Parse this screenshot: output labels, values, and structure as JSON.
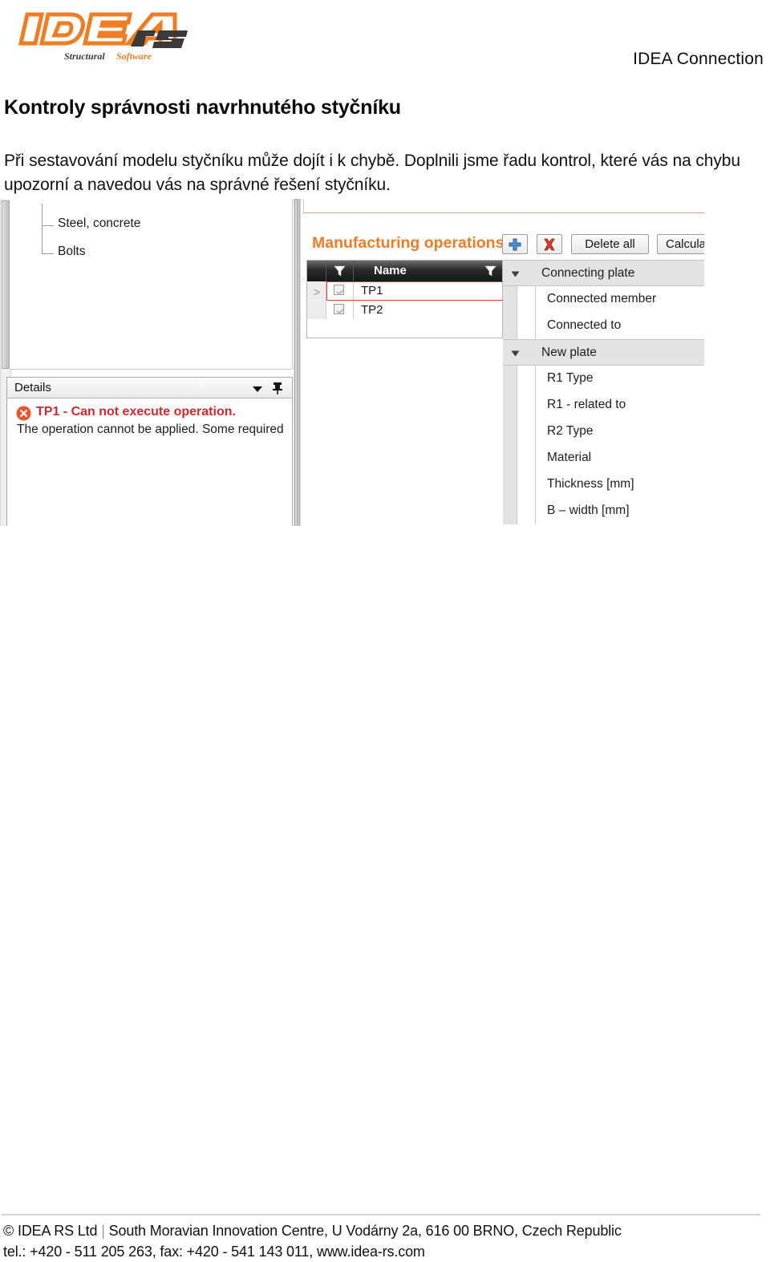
{
  "header": {
    "logo": {
      "name": "idea-rs-logo",
      "word_mark": "IDEA",
      "word_mark_suffix": "rs",
      "tagline_dark": "Structural",
      "tagline_orange": "Software",
      "orange": "#f07d23",
      "dark": "#3a3a3a"
    },
    "app_name": "IDEA Connection"
  },
  "page_title": "Kontroly správnosti navrhnutého styčníku",
  "intro_paragraph": "Při sestavování modelu styčníku může dojít i k chybě. Doplnili jsme řadu kontrol, které vás na chybu upozorní a navedou vás na správné řešení styčníku.",
  "screenshot": {
    "tree": {
      "items": [
        {
          "label": "Steel, concrete"
        },
        {
          "label": "Bolts"
        }
      ]
    },
    "details": {
      "title": "Details",
      "caret_icon": "chevron-down-icon",
      "pin_icon": "pin-icon",
      "error": {
        "icon": "error-circle-icon",
        "title": "TP1 - Can not execute operation.",
        "description": "The operation cannot be applied. Some required",
        "title_color": "#d2282e"
      }
    },
    "operations": {
      "title": "Manufacturing operations",
      "title_color": "#ef7c23",
      "toolbar": {
        "add_icon": "plus-icon",
        "delete_icon": "red-x-icon",
        "delete_all_label": "Delete all",
        "calculate_label": "Calcula"
      },
      "grid": {
        "columns": [
          "",
          "",
          "Name"
        ],
        "filter_icon": "filter-funnel-icon",
        "rows": [
          {
            "arrow": ">",
            "checked": true,
            "name": "TP1",
            "selected": true
          },
          {
            "arrow": "",
            "checked": true,
            "name": "TP2",
            "selected": false
          }
        ],
        "selection_color": "#e03a31"
      }
    },
    "properties": {
      "rows": [
        {
          "label": "Connecting plate",
          "type": "group",
          "expanded": true
        },
        {
          "label": "Connected member",
          "type": "leaf"
        },
        {
          "label": "Connected to",
          "type": "leaf"
        },
        {
          "label": "New plate",
          "type": "group",
          "expanded": true
        },
        {
          "label": "R1 Type",
          "type": "leaf"
        },
        {
          "label": "R1 - related to",
          "type": "leaf"
        },
        {
          "label": "R2 Type",
          "type": "leaf"
        },
        {
          "label": "Material",
          "type": "leaf"
        },
        {
          "label": "Thickness [mm]",
          "type": "leaf"
        },
        {
          "label": "B – width [mm]",
          "type": "leaf"
        }
      ]
    }
  },
  "footer": {
    "line1_prefix": "© IDEA RS Ltd",
    "line1_separator": "|",
    "line1_rest": "South Moravian Innovation Centre, U Vodárny 2a, 616 00 BRNO, Czech Republic",
    "line2": "tel.: +420 - 511 205 263, fax: +420 - 541 143 011, www.idea-rs.com"
  }
}
